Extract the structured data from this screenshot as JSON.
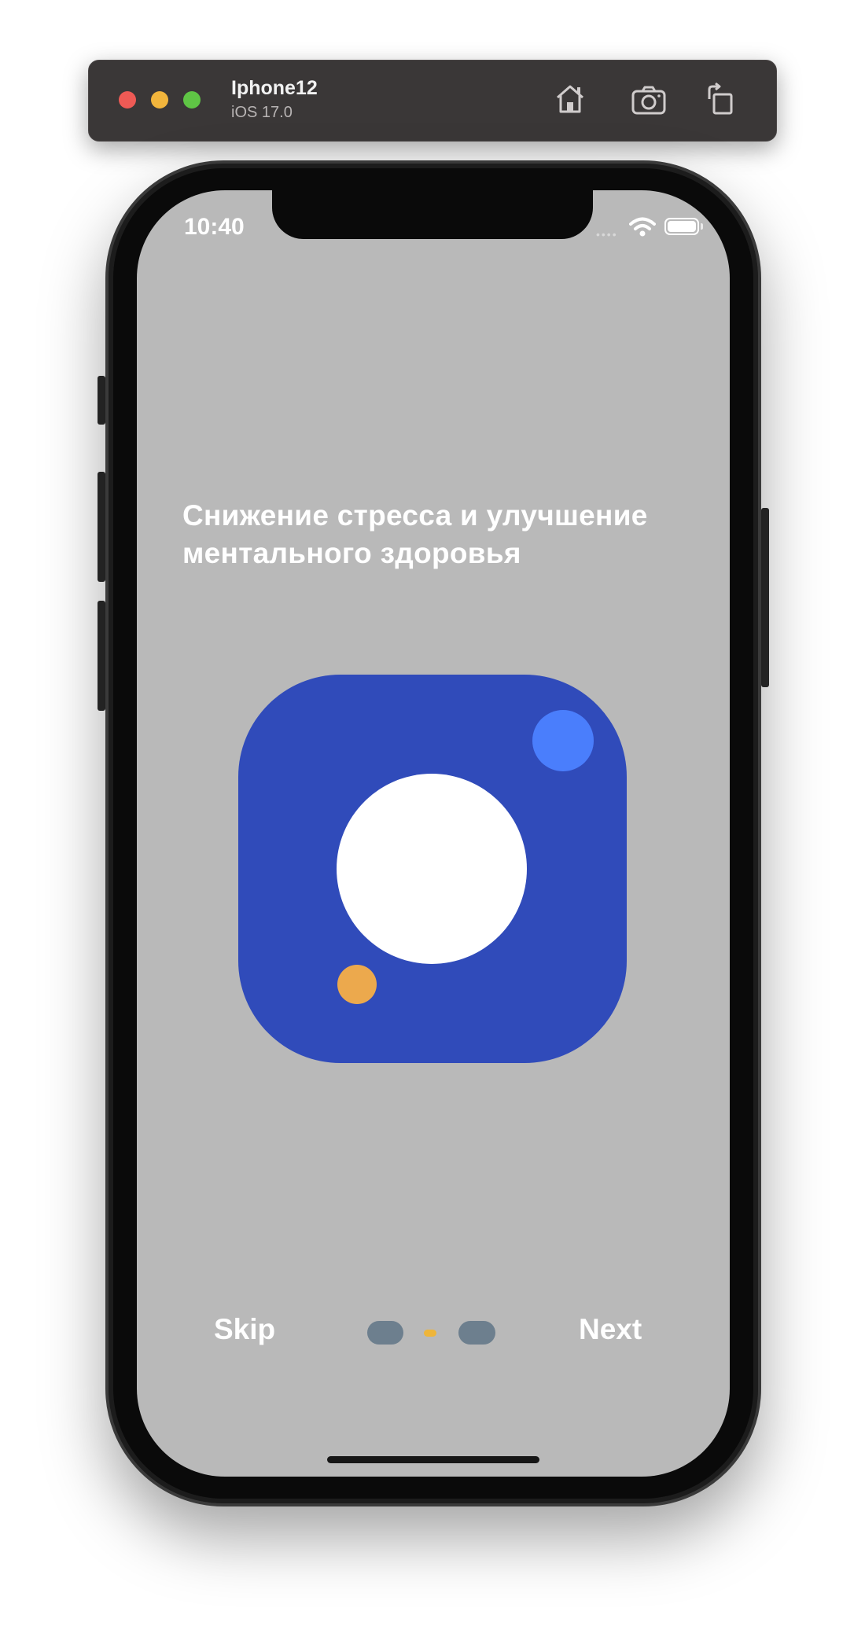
{
  "simulator": {
    "device_name": "Iphone12",
    "os_version": "iOS 17.0",
    "toolbar_icons": [
      "home-icon",
      "screenshot-icon",
      "rotate-icon"
    ]
  },
  "status_bar": {
    "time": "10:40",
    "icons": [
      "cellular-icon",
      "wifi-icon",
      "battery-icon"
    ]
  },
  "onboarding": {
    "headline": "Снижение стресса и улучшение ментального здоровья",
    "illustration": {
      "background": "#304bba",
      "main_circle": "#ffffff",
      "accent_circle": "#4a7efc",
      "small_circle": "#eca94d"
    },
    "skip_label": "Skip",
    "next_label": "Next",
    "page_indicator": {
      "pages": 3,
      "current": 2,
      "active_color": "#eeb53a",
      "inactive_color": "#6d7f8e"
    }
  },
  "colors": {
    "screen_background": "#b9b9b9",
    "toolbar_background": "#3a3737"
  }
}
